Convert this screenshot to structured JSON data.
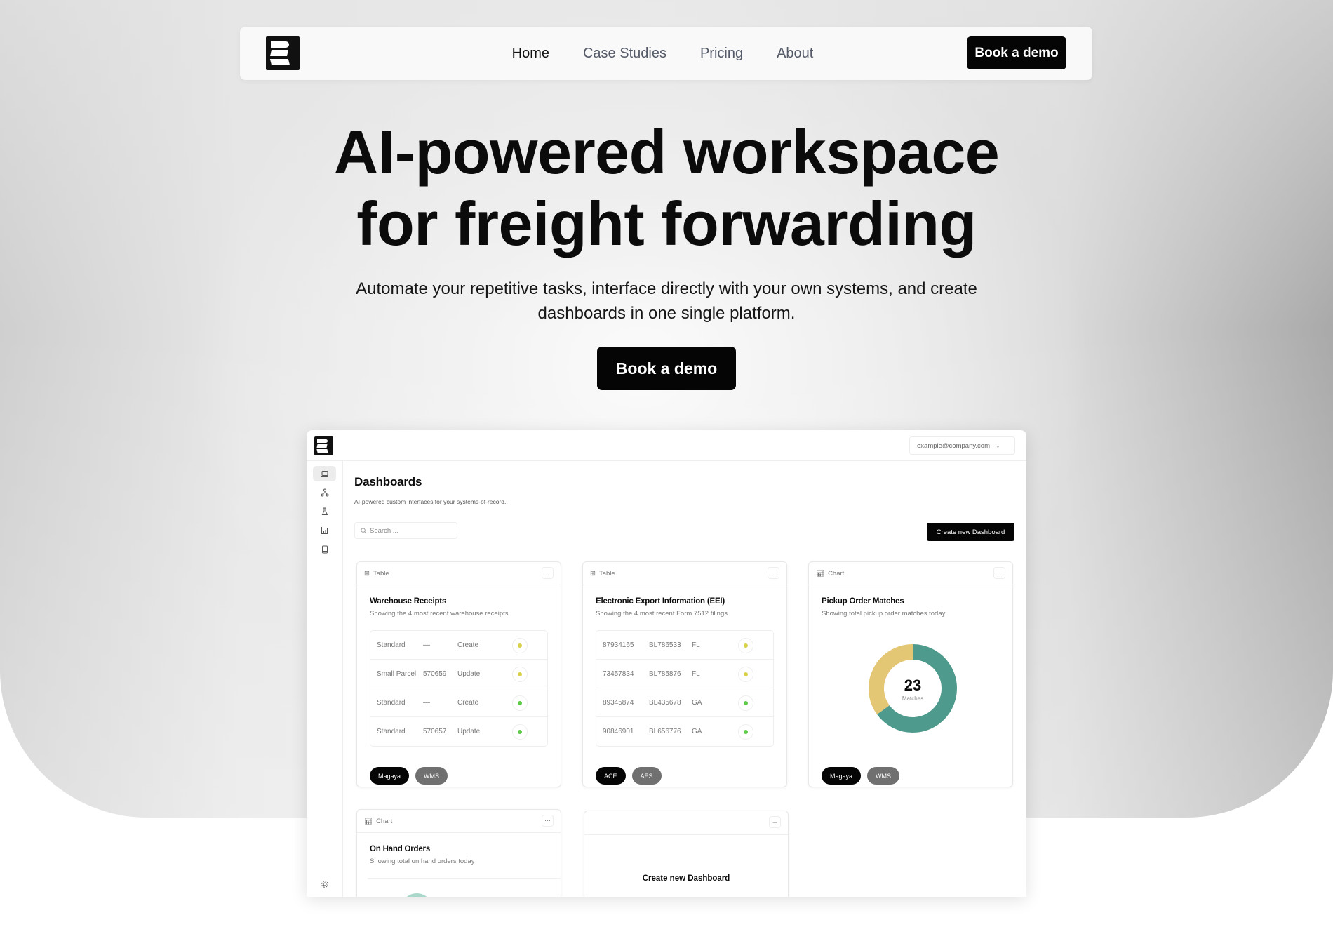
{
  "nav": {
    "links": [
      {
        "label": "Home",
        "active": true
      },
      {
        "label": "Case Studies"
      },
      {
        "label": "Pricing"
      },
      {
        "label": "About"
      }
    ],
    "cta": "Book a demo"
  },
  "hero": {
    "title_line1": "AI-powered workspace",
    "title_line2": "for freight forwarding",
    "subtitle": "Automate your repetitive tasks, interface directly with your own systems, and create dashboards in one single platform.",
    "cta": "Book a demo"
  },
  "app": {
    "account": "example@company.com",
    "sidebar": {
      "icons": [
        "laptop-icon",
        "network-icon",
        "flask-icon",
        "bar-chart-icon",
        "book-icon"
      ],
      "footer_icon": "gear-icon"
    },
    "page_title": "Dashboards",
    "page_subtitle": "AI-powered custom interfaces for your systems-of-record.",
    "search_placeholder": "Search ...",
    "create_button": "Create new Dashboard",
    "cards": [
      {
        "type": "Table",
        "title": "Warehouse Receipts",
        "subtitle": "Showing the 4 most recent warehouse receipts",
        "rows": [
          [
            "Standard",
            "—",
            "Create",
            "yellow"
          ],
          [
            "Small Parcel",
            "570659",
            "Update",
            "yellow"
          ],
          [
            "Standard",
            "—",
            "Create",
            "green"
          ],
          [
            "Standard",
            "570657",
            "Update",
            "green"
          ]
        ],
        "tags": [
          "Magaya",
          "WMS"
        ]
      },
      {
        "type": "Table",
        "title": "Electronic Export Information (EEI)",
        "subtitle": "Showing the 4 most recent Form 7512 filings",
        "rows": [
          [
            "87934165",
            "BL786533",
            "FL",
            "yellow"
          ],
          [
            "73457834",
            "BL785876",
            "FL",
            "yellow"
          ],
          [
            "89345874",
            "BL435678",
            "GA",
            "green"
          ],
          [
            "90846901",
            "BL656776",
            "GA",
            "green"
          ]
        ],
        "tags": [
          "ACE",
          "AES"
        ]
      },
      {
        "type": "Chart",
        "title": "Pickup Order Matches",
        "subtitle": "Showing total pickup order matches today",
        "value": "23",
        "value_label": "Matches",
        "segments": [
          {
            "share": 0.65,
            "color": "#4e9a8c"
          },
          {
            "share": 0.35,
            "color": "#e4c775"
          }
        ],
        "tags": [
          "Magaya",
          "WMS"
        ]
      },
      {
        "type": "Chart",
        "title": "On Hand Orders",
        "subtitle": "Showing total on hand orders today"
      },
      {
        "title": "Create new Dashboard"
      }
    ],
    "status_colors": {
      "yellow": "#d9d14a",
      "green": "#5fc94a"
    },
    "tag_colors": [
      "#050505",
      "#707070"
    ]
  }
}
